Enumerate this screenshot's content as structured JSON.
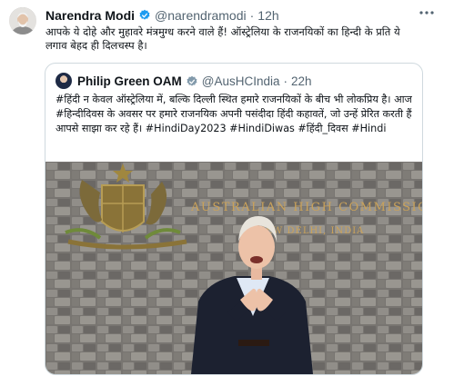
{
  "tweet": {
    "author_name": "Narendra Modi",
    "handle": "@narendramodi",
    "separator": "·",
    "time": "12h",
    "more_icon": "more-horizontal-icon",
    "text": "आपके ये दोहे और मुहावरे मंत्रमुग्ध करने वाले हैं! ऑस्ट्रेलिया के राजनयिकों का हिन्दी के प्रति ये लगाव बेहद ही दिलचस्प है।"
  },
  "quote": {
    "author_name": "Philip Green OAM",
    "handle": "@AusHCIndia",
    "separator": "·",
    "time": "22h",
    "text": "#हिंदी न केवल ऑस्ट्रेलिया में, बल्कि दिल्ली स्थित हमारे राजनयिकों के बीच भी लोकप्रिय है। आज #हिन्दीदिवस के अवसर पर हमारे राजनयिक अपनी पसंदीदा हिंदी कहावतें, जो उन्हें प्रेरित करती हैं आपसे साझा कर रहे हैं। #HindiDay2023 #HindiDiwas #हिंदी_दिवस #Hindi",
    "image": {
      "sign_line1": "AUSTRALIAN HIGH COMMISSION",
      "sign_line2": "NEW DELHI, INDIA"
    }
  },
  "colors": {
    "verified": "#1d9bf0",
    "muted": "#536471",
    "border": "#cfd9de",
    "stone": "#8d8b86"
  }
}
